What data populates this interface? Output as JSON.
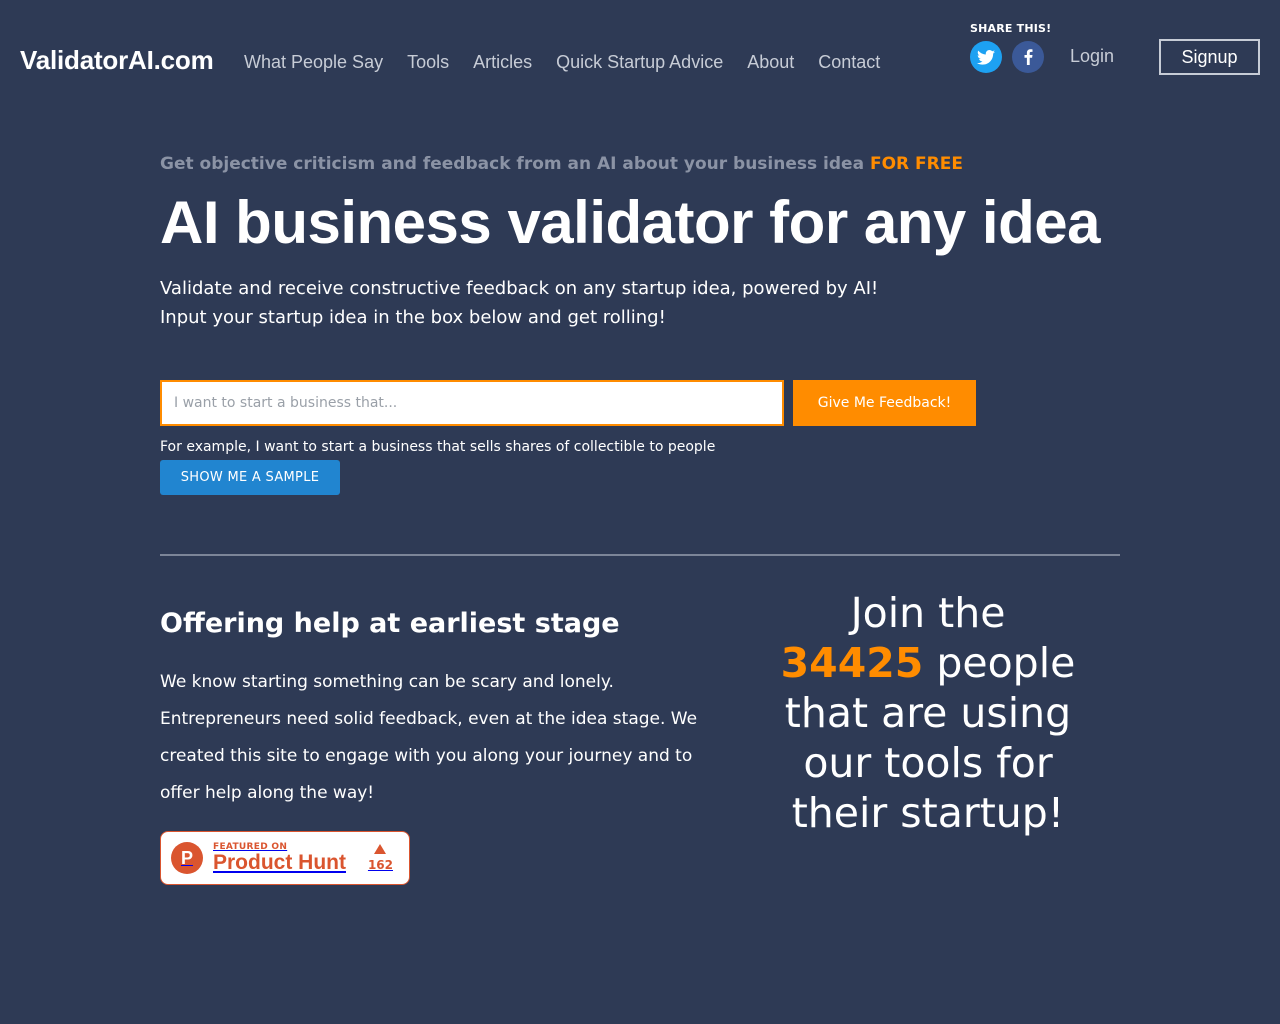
{
  "header": {
    "brand": "ValidatorAI.com",
    "nav": [
      "What People Say",
      "Tools",
      "Articles",
      "Quick Startup Advice",
      "About",
      "Contact"
    ],
    "share_label": "SHARE THIS!",
    "social_icons": [
      "twitter-icon",
      "facebook-icon"
    ],
    "login": "Login",
    "signup": "Signup"
  },
  "hero": {
    "kicker": "Get objective criticism and feedback from an AI about your business idea",
    "kicker_highlight": "FOR FREE",
    "headline": "AI business validator for any idea",
    "subline1": "Validate and receive constructive feedback on any startup idea, powered by AI!",
    "subline2": "Input your startup idea in the box below and get rolling!",
    "input_placeholder": "I want to start a business that...",
    "input_value": "",
    "feedback_button": "Give Me Feedback!",
    "example": "For example, I want to start a business that sells shares of collectible to people",
    "sample_button": "SHOW ME A SAMPLE"
  },
  "section": {
    "title": "Offering help at earliest stage",
    "body": "We know starting something can be scary and lonely. Entrepreneurs need solid feedback, even at the idea stage. We created this site to engage with you along your journey and to offer help along the way!",
    "badge": {
      "small": "FEATURED ON",
      "name": "Product Hunt",
      "votes": "162"
    }
  },
  "join": {
    "prefix": "Join the",
    "count": "34425",
    "suffix": "people that are using our tools for their startup!"
  },
  "colors": {
    "background": "#2e3a55",
    "accent_orange": "#ff8c00",
    "button_blue": "#2185d0",
    "twitter": "#1da1f2",
    "facebook": "#3b5998",
    "product_hunt": "#da552f"
  }
}
